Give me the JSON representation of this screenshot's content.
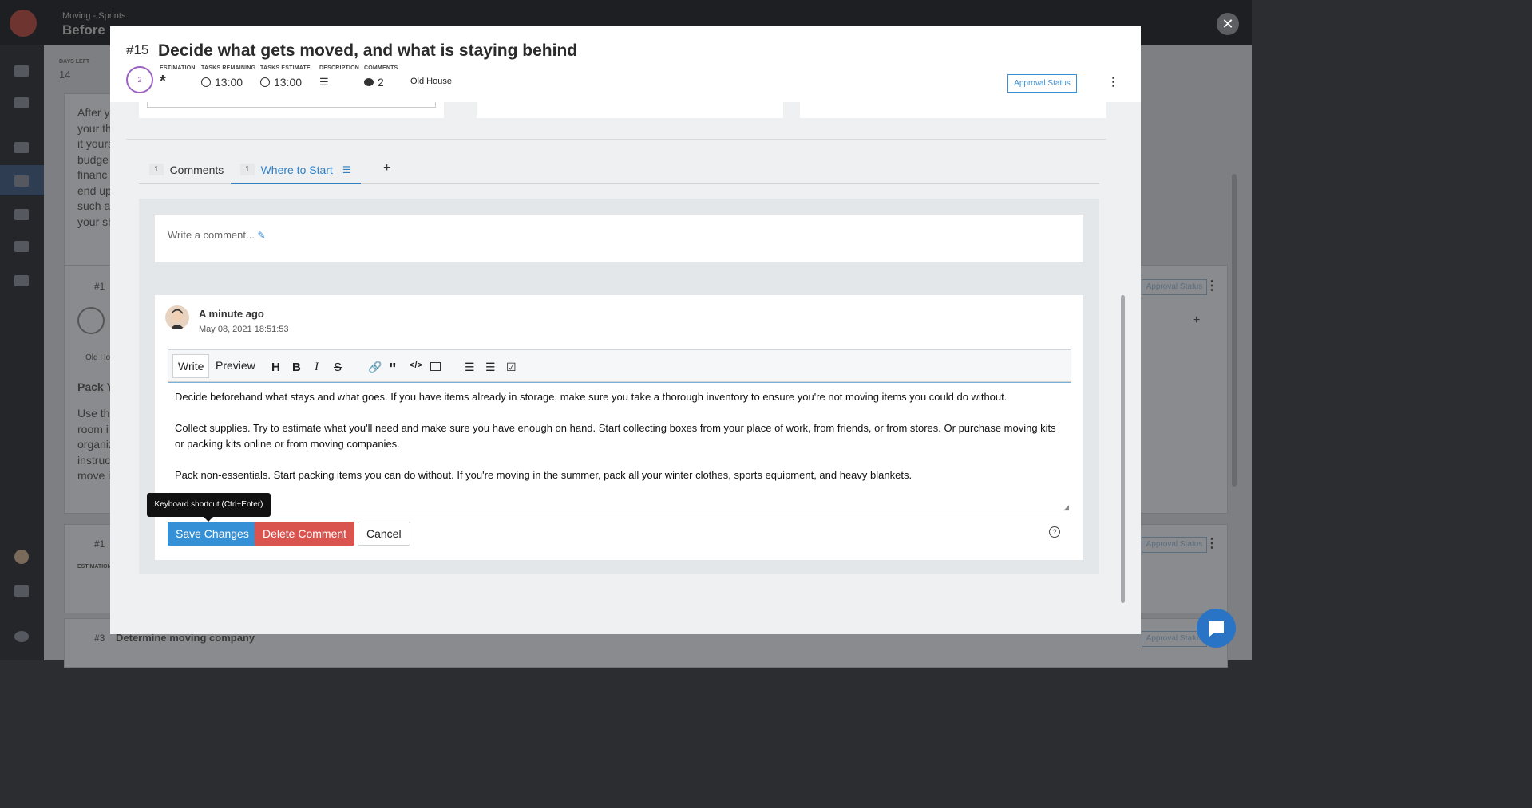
{
  "background": {
    "breadcrumb": "Moving - Sprints",
    "title": "Before",
    "days_left_label": "DAYS LEFT",
    "days_left_value": "14",
    "card_text": [
      "After y",
      "your th",
      "it yours",
      "budge",
      "financ",
      "end up",
      "such as",
      "your sh"
    ],
    "card2_title": "Pack Y",
    "card2_text": [
      "Use the",
      "room i",
      "organiz",
      "instruc",
      "move i"
    ],
    "card2_tag": "Old Ho",
    "row_labels": [
      "#1",
      "#1",
      "#3"
    ],
    "estimation_label": "ESTIMATION",
    "bottom_row_title": "Determine moving company",
    "approval_label": "Approval Status"
  },
  "modal": {
    "number": "#15",
    "title": "Decide what gets moved, and what is staying behind",
    "points": "2",
    "meta": [
      {
        "label": "ESTIMATION",
        "value": "",
        "icon": "asterisk-icon"
      },
      {
        "label": "TASKS REMAINING",
        "value": "13:00",
        "icon": "clock-icon"
      },
      {
        "label": "TASKS ESTIMATE",
        "value": "13:00",
        "icon": "clock-icon"
      },
      {
        "label": "DESCRIPTION",
        "value": "",
        "icon": "align-left-icon"
      },
      {
        "label": "COMMENTS",
        "value": "2",
        "icon": "comment-icon"
      }
    ],
    "tag": "Old House",
    "approval_status": "Approval Status",
    "tabs": [
      {
        "count": "1",
        "label": "Comments"
      },
      {
        "count": "1",
        "label": "Where to Start"
      }
    ],
    "add_tab": "+",
    "write_placeholder": "Write a comment...",
    "comment": {
      "author": "A minute ago",
      "date": "May 08, 2021 18:51:53",
      "toolbar": {
        "write": "Write",
        "preview": "Preview"
      },
      "paragraphs": [
        "Decide beforehand what stays and what goes. If you have items already in storage, make sure you take a thorough inventory to ensure you're not moving items you could do without.",
        "Collect supplies. Try to estimate what you'll need and make sure you have enough on hand. Start collecting boxes from your place of work, from friends, or from stores. Or purchase moving kits or packing kits online or from moving companies.",
        "Pack non-essentials. Start packing items you can do without. If you're moving in the summer, pack all your winter clothes, sports equipment, and heavy blankets."
      ],
      "save": "Save Changes",
      "delete": "Delete Comment",
      "cancel": "Cancel",
      "tooltip": "Keyboard shortcut (Ctrl+Enter)"
    }
  },
  "colors": {
    "accent": "#3590d6",
    "danger": "#d9534f",
    "points_ring": "#9d62c0"
  }
}
